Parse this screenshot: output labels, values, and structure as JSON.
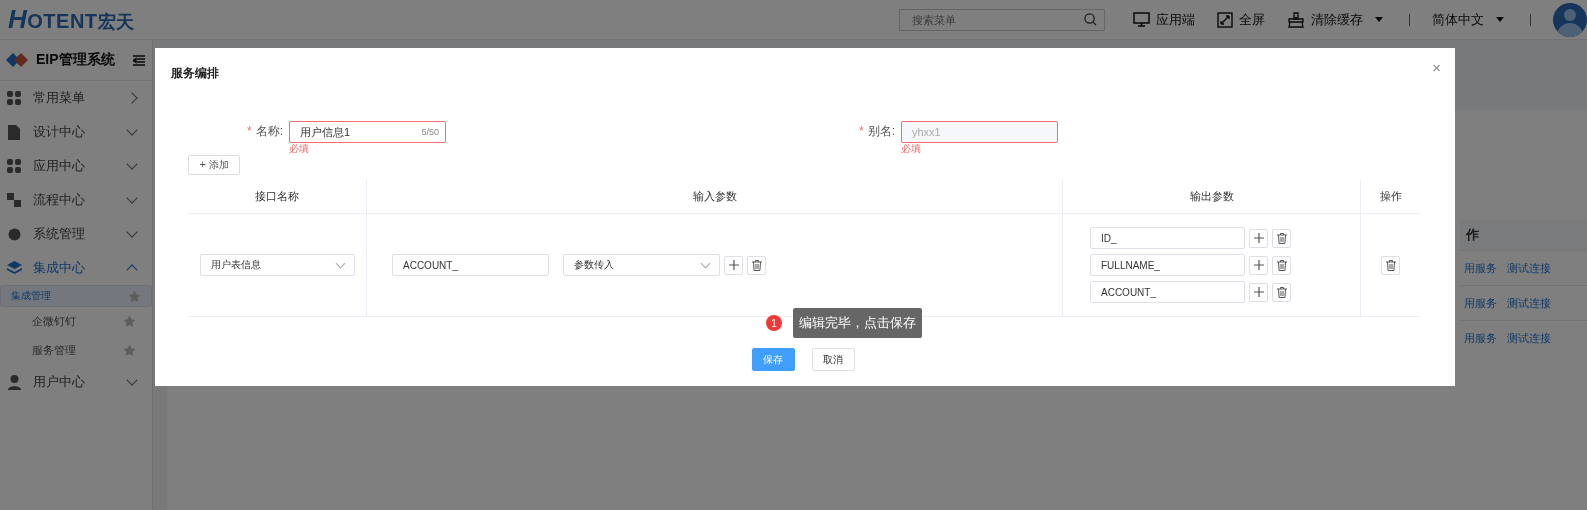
{
  "header": {
    "logo_mark": "H",
    "logo_text": "OTENT",
    "logo_cn": "宏天",
    "search": {
      "placeholder": "搜索菜单"
    },
    "actions": [
      {
        "kind": "monitor",
        "label": "应用端",
        "dropdown": false
      },
      {
        "kind": "fullscreen",
        "label": "全屏",
        "dropdown": false
      },
      {
        "kind": "clean",
        "label": "清除缓存",
        "dropdown": true
      }
    ],
    "language": {
      "label": "简体中文",
      "dropdown": true
    }
  },
  "sidebar": {
    "title": "EIP管理系统",
    "items": [
      {
        "label": "常用菜单",
        "kind": "link",
        "expanded": false
      },
      {
        "label": "设计中心",
        "kind": "group",
        "expanded": false
      },
      {
        "label": "应用中心",
        "kind": "group",
        "expanded": false
      },
      {
        "label": "流程中心",
        "kind": "group",
        "expanded": false
      },
      {
        "label": "系统管理",
        "kind": "group",
        "expanded": false
      },
      {
        "label": "集成中心",
        "kind": "group",
        "expanded": true,
        "children": [
          {
            "label": "集成管理",
            "selected": true
          },
          {
            "label": "企微钉钉",
            "selected": false
          },
          {
            "label": "服务管理",
            "selected": false
          }
        ]
      },
      {
        "label": "用户中心",
        "kind": "group",
        "expanded": false
      }
    ]
  },
  "background_table": {
    "header": "作",
    "rows": [
      {
        "links": [
          "用服务",
          "测试连接"
        ]
      },
      {
        "links": [
          "用服务",
          "测试连接"
        ]
      },
      {
        "links": [
          "用服务",
          "测试连接"
        ]
      }
    ]
  },
  "dialog": {
    "title": "服务编排",
    "close": "×",
    "fields": [
      {
        "required_mark": "*",
        "label": "名称:",
        "value": "用户信息1",
        "count": "5/50",
        "error": "必填",
        "disabled": false
      },
      {
        "required_mark": "*",
        "label": "别名:",
        "value": "yhxx1",
        "error": "必填",
        "disabled": true
      }
    ],
    "add_button": {
      "icon": "+",
      "label": "添加"
    },
    "table": {
      "columns": [
        "接口名称",
        "输入参数",
        "输出参数",
        "操作"
      ],
      "rows": [
        {
          "interface": "用户表信息",
          "inputs": [
            {
              "name": "ACCOUNT_",
              "source": "参数传入"
            }
          ],
          "outputs": [
            "ID_",
            "FULLNAME_",
            "ACCOUNT_"
          ]
        }
      ]
    },
    "tooltip": {
      "step": "1",
      "text": "编辑完毕，点击保存"
    },
    "buttons": [
      {
        "label": "保存",
        "kind": "primary"
      },
      {
        "label": "取消",
        "kind": "default"
      }
    ]
  }
}
